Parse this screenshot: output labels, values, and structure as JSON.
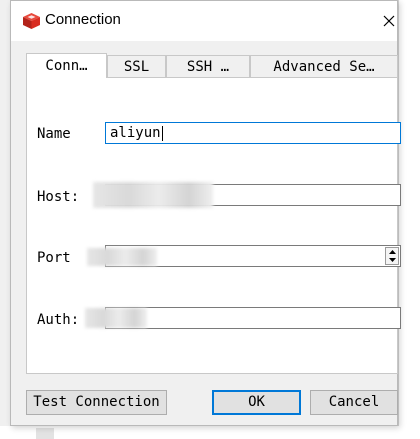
{
  "window": {
    "title": "Connection",
    "close_glyph": "✕",
    "icon": "redis-cube-icon"
  },
  "tabs": [
    {
      "label": "Conn…",
      "active": true
    },
    {
      "label": "SSL",
      "active": false
    },
    {
      "label": "SSH …",
      "active": false
    },
    {
      "label": "Advanced Se…",
      "active": false
    }
  ],
  "form": {
    "name_label": "Name",
    "name_value": "aliyun",
    "host_label": "Host:",
    "host_value": "",
    "port_label": "Port",
    "port_value": "",
    "auth_label": "Auth:",
    "auth_value": ""
  },
  "buttons": {
    "test_connection": "Test Connection",
    "ok": "OK",
    "cancel": "Cancel"
  },
  "colors": {
    "focus_border": "#0078d7",
    "icon_red": "#d82c20"
  }
}
